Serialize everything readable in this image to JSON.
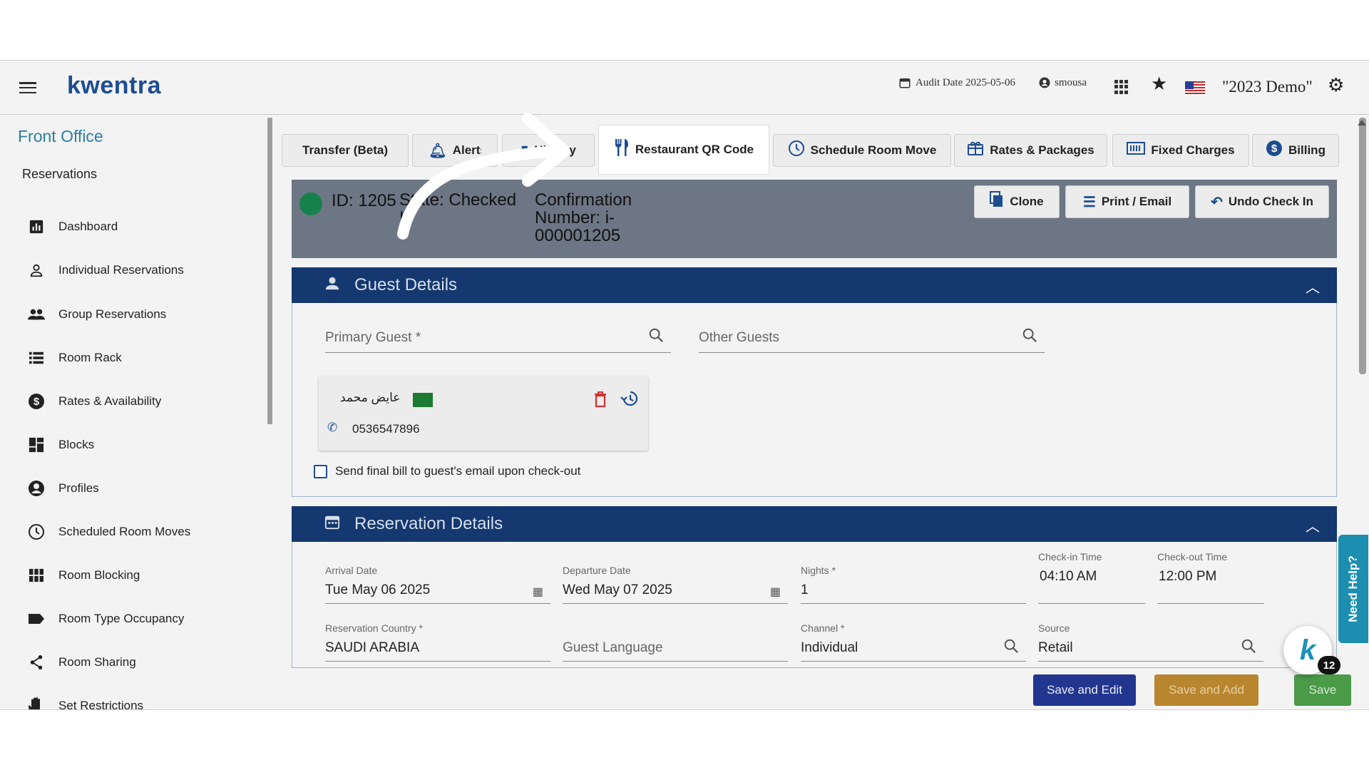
{
  "header": {
    "logo": "kwentra",
    "audit_date": "Audit Date 2025-05-06",
    "username": "smousa",
    "property": "\"2023 Demo\""
  },
  "sidebar": {
    "title": "Front Office",
    "section": "Reservations",
    "items": [
      {
        "label": "Dashboard",
        "icon": "chart-icon"
      },
      {
        "label": "Individual Reservations",
        "icon": "person-icon"
      },
      {
        "label": "Group Reservations",
        "icon": "people-icon"
      },
      {
        "label": "Room Rack",
        "icon": "list-icon"
      },
      {
        "label": "Rates & Availability",
        "icon": "dollar-icon"
      },
      {
        "label": "Blocks",
        "icon": "grid-icon"
      },
      {
        "label": "Profiles",
        "icon": "account-circle-icon"
      },
      {
        "label": "Scheduled Room Moves",
        "icon": "clock-icon"
      },
      {
        "label": "Room Blocking",
        "icon": "block-grid-icon"
      },
      {
        "label": "Room Type Occupancy",
        "icon": "label-icon"
      },
      {
        "label": "Room Sharing",
        "icon": "share-icon"
      },
      {
        "label": "Set Restrictions",
        "icon": "hand-icon"
      }
    ]
  },
  "tabs": {
    "transfer": "Transfer (Beta)",
    "alerts": "Alerts",
    "history": "History",
    "restaurant_qr": "Restaurant QR Code",
    "schedule_move": "Schedule Room Move",
    "rates_packages": "Rates & Packages",
    "fixed_charges": "Fixed Charges",
    "billing": "Billing"
  },
  "reservation": {
    "id": "ID: 1205",
    "state": "State: Checked In",
    "confirmation": "Confirmation Number: i-000001205",
    "clone": "Clone",
    "print_email": "Print / Email",
    "undo_checkin": "Undo Check In"
  },
  "guest_details": {
    "title": "Guest Details",
    "primary_guest_placeholder": "Primary Guest *",
    "other_guests_placeholder": "Other Guests",
    "guest_name": "عايض محمد",
    "guest_phone": "0536547896",
    "send_bill_label": "Send final bill to guest's email upon check-out"
  },
  "reservation_details": {
    "title": "Reservation Details",
    "arrival_label": "Arrival Date",
    "arrival_value": "Tue May 06 2025",
    "departure_label": "Departure Date",
    "departure_value": "Wed May 07 2025",
    "nights_label": "Nights *",
    "nights_value": "1",
    "checkin_label": "Check-in Time",
    "checkin_value": "04:10 AM",
    "checkout_label": "Check-out Time",
    "checkout_value": "12:00 PM",
    "country_label": "Reservation Country *",
    "country_value": "SAUDI ARABIA",
    "language_placeholder": "Guest Language",
    "channel_label": "Channel *",
    "channel_value": "Individual",
    "source_label": "Source",
    "source_value": "Retail"
  },
  "footer": {
    "save_edit": "Save and Edit",
    "save_add": "Save and Add",
    "save": "Save"
  },
  "help": {
    "need_help": "Need Help?",
    "badge_count": "12"
  },
  "colors": {
    "brand_navy": "#14386f",
    "accent_blue": "#1d4d8f",
    "teal_title": "#2a7fa0",
    "status_green": "#17814b",
    "save_add_orange": "#b8862f",
    "save_green": "#4a9a48"
  }
}
